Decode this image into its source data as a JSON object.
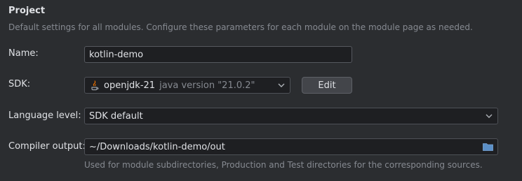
{
  "section": {
    "title": "Project",
    "description": "Default settings for all modules. Configure these parameters for each module on the module page as needed."
  },
  "name": {
    "label": "Name:",
    "value": "kotlin-demo"
  },
  "sdk": {
    "label": "SDK:",
    "selected": "openjdk-21",
    "version": "java version \"21.0.2\"",
    "edit_label": "Edit",
    "icon": "java-icon"
  },
  "language_level": {
    "label": "Language level:",
    "selected": "SDK default"
  },
  "compiler_output": {
    "label": "Compiler output:",
    "value": "~/Downloads/kotlin-demo/out",
    "hint": "Used for module subdirectories, Production and Test directories for the corresponding sources.",
    "icon": "folder-icon"
  },
  "colors": {
    "background": "#2b2d30",
    "field_background": "#1e1f22",
    "accent_focus": "#56595f"
  }
}
